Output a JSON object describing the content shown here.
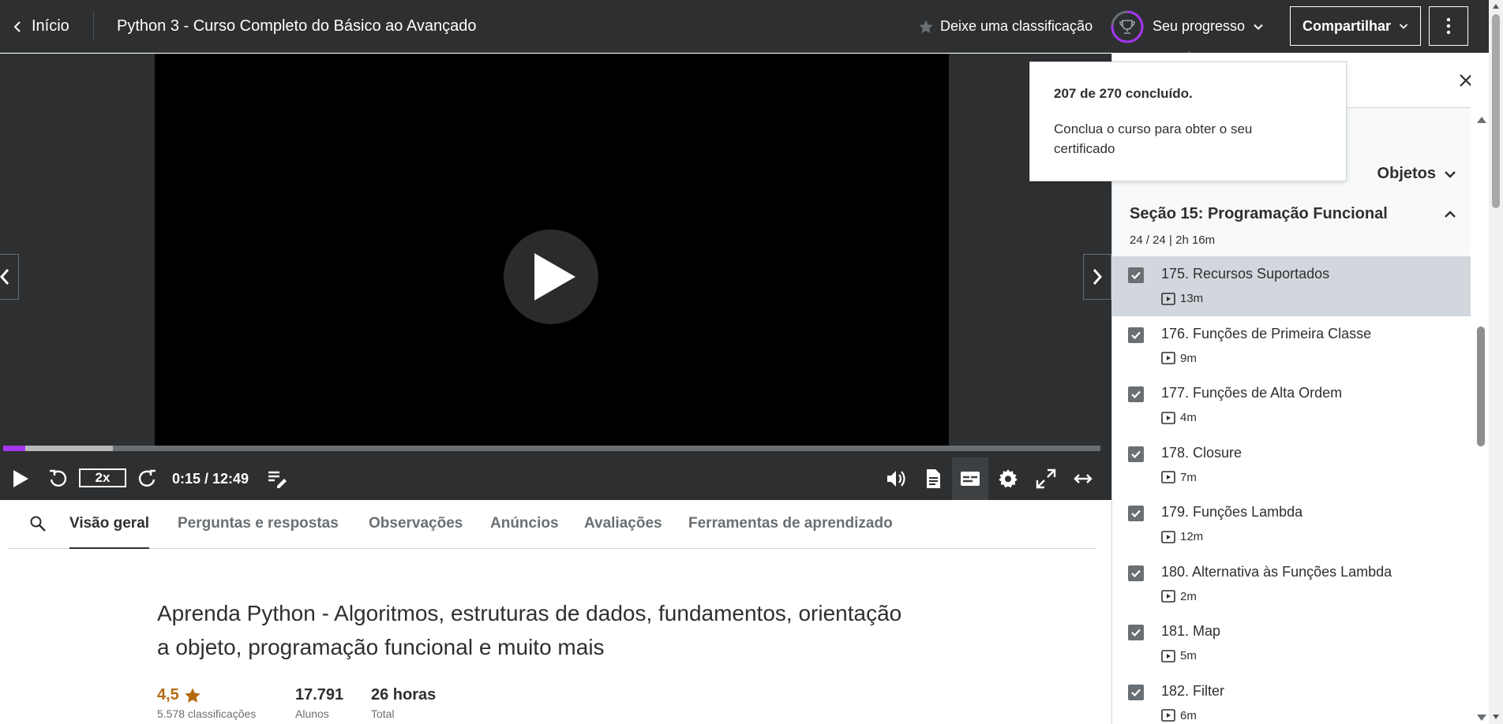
{
  "header": {
    "back_label": "Início",
    "course_title": "Python 3 - Curso Completo do Básico ao Avançado",
    "rate_label": "Deixe uma classificação",
    "progress_label": "Seu progresso",
    "share_label": "Compartilhar"
  },
  "progress": {
    "completed": 207,
    "total": 270,
    "summary": "207 de 270 concluído.",
    "message": "Conclua o curso para obter o seu certificado"
  },
  "player": {
    "speed": "2x",
    "time": "0:15 / 12:49",
    "played_fraction": 0.02,
    "buffered_fraction": 0.1,
    "colors": {
      "accent": "#a435f0",
      "background": "#2d2f31"
    }
  },
  "tabs": [
    {
      "label": "Visão geral",
      "active": true
    },
    {
      "label": "Perguntas e respostas",
      "active": false
    },
    {
      "label": "Observações",
      "active": false
    },
    {
      "label": "Anúncios",
      "active": false
    },
    {
      "label": "Avaliações",
      "active": false
    },
    {
      "label": "Ferramentas de aprendizado",
      "active": false
    }
  ],
  "overview": {
    "headline": "Aprenda Python - Algoritmos, estruturas de dados, fundamentos, orientação a objeto, programação funcional e muito mais",
    "rating_value": "4,5",
    "rating_label": "5.578 classificações",
    "students_value": "17.791",
    "students_label": "Alunos",
    "duration_value": "26 horas",
    "duration_label": "Total"
  },
  "sidebar": {
    "prev_section_title_fragment": "Objetos",
    "section": {
      "title": "Seção 15: Programação Funcional",
      "meta": "24 / 24 | 2h 16m"
    },
    "lessons": [
      {
        "title": "175. Recursos Suportados",
        "duration": "13m",
        "done": true,
        "current": true
      },
      {
        "title": "176. Funções de Primeira Classe",
        "duration": "9m",
        "done": true,
        "current": false
      },
      {
        "title": "177. Funções de Alta Ordem",
        "duration": "4m",
        "done": true,
        "current": false
      },
      {
        "title": "178. Closure",
        "duration": "7m",
        "done": true,
        "current": false
      },
      {
        "title": "179. Funções Lambda",
        "duration": "12m",
        "done": true,
        "current": false
      },
      {
        "title": "180. Alternativa às Funções Lambda",
        "duration": "2m",
        "done": true,
        "current": false
      },
      {
        "title": "181. Map",
        "duration": "5m",
        "done": true,
        "current": false
      },
      {
        "title": "182. Filter",
        "duration": "6m",
        "done": true,
        "current": false
      }
    ]
  }
}
